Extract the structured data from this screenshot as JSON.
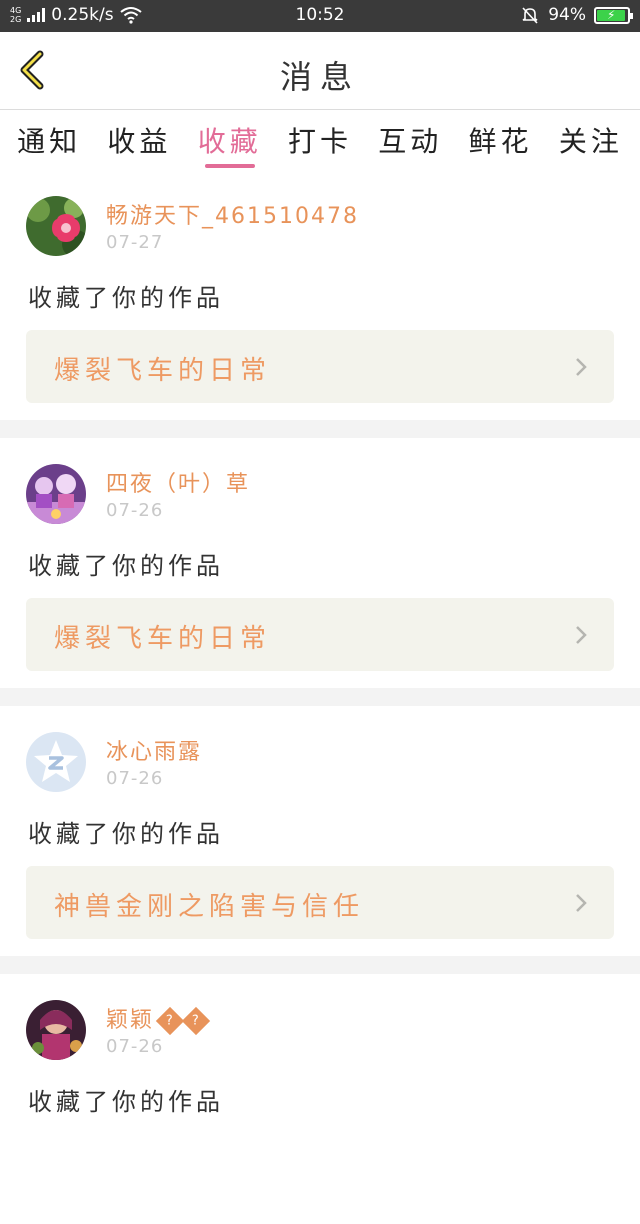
{
  "status_bar": {
    "network_top": "4G",
    "network_bottom": "2G",
    "speed": "0.25k/s",
    "time": "10:52",
    "battery": "94%",
    "battery_level": 0.94,
    "battery_color": "#3cd24a"
  },
  "header": {
    "title": "消息"
  },
  "tabs": [
    {
      "label": "通知"
    },
    {
      "label": "收益"
    },
    {
      "label": "收藏",
      "active": true
    },
    {
      "label": "打卡"
    },
    {
      "label": "互动"
    },
    {
      "label": "鲜花"
    },
    {
      "label": "关注"
    }
  ],
  "accent_color": "#e26c97",
  "messages": [
    {
      "username": "畅游天下_461510478",
      "date": "07-27",
      "action": "收藏了你的作品",
      "work_title": "爆裂飞车的日常",
      "avatar": "flower-photo"
    },
    {
      "username": "四夜（叶）草",
      "date": "07-26",
      "action": "收藏了你的作品",
      "work_title": "爆裂飞车的日常",
      "avatar": "anime-photo"
    },
    {
      "username": "冰心雨露",
      "date": "07-26",
      "action": "收藏了你的作品",
      "work_title": "神兽金刚之陷害与信任",
      "avatar": "default-star-avatar"
    },
    {
      "username": "颖颖",
      "badges": [
        "?",
        "?"
      ],
      "date": "07-26",
      "action": "收藏了你的作品",
      "avatar": "character-photo"
    }
  ]
}
